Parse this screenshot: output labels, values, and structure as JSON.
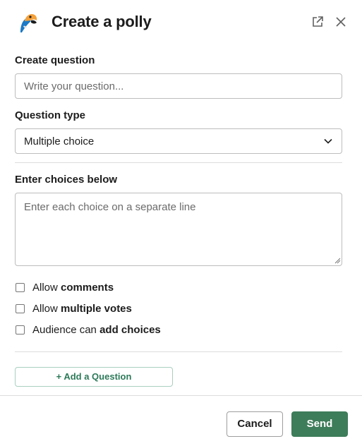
{
  "header": {
    "title": "Create a polly",
    "logo_icon": "polly-parrot-logo",
    "popout_icon": "external-link-icon",
    "close_icon": "close-icon"
  },
  "question": {
    "label": "Create question",
    "placeholder": "Write your question...",
    "value": ""
  },
  "question_type": {
    "label": "Question type",
    "selected": "Multiple choice"
  },
  "choices": {
    "label": "Enter choices below",
    "placeholder": "Enter each choice on a separate line",
    "value": ""
  },
  "options": [
    {
      "prefix": "Allow ",
      "bold": "comments",
      "checked": false
    },
    {
      "prefix": "Allow ",
      "bold": "multiple votes",
      "checked": false
    },
    {
      "prefix": "Audience can ",
      "bold": "add choices",
      "checked": false
    }
  ],
  "add_question_label": "+ Add a Question",
  "footer": {
    "cancel_label": "Cancel",
    "send_label": "Send"
  },
  "colors": {
    "primary": "#3e7d5a",
    "accent_text": "#2d7a5a",
    "logo_blue": "#1b7ac6",
    "logo_orange": "#f4a13a"
  }
}
